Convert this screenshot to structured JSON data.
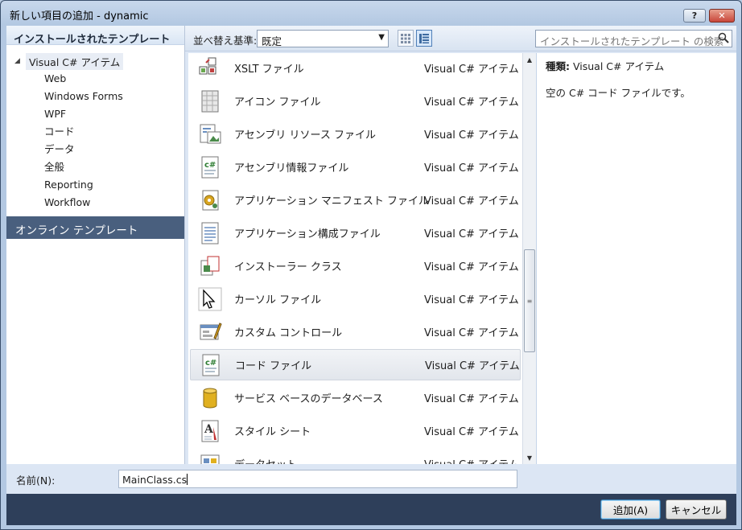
{
  "window": {
    "title": "新しい項目の追加 - dynamic",
    "help_label": "?",
    "close_label": "✕"
  },
  "left_pane": {
    "header": "インストールされたテンプレート",
    "tree_root": "Visual C# アイテム",
    "tree_children": [
      "Web",
      "Windows Forms",
      "WPF",
      "コード",
      "データ",
      "全般",
      "Reporting",
      "Workflow"
    ],
    "online_templates": "オンライン テンプレート"
  },
  "toolbar": {
    "sort_label": "並べ替え基準:",
    "sort_value": "既定",
    "search_placeholder": "インストールされたテンプレート の検索"
  },
  "templates": [
    {
      "name": "XSLT ファイル",
      "kind": "Visual C# アイテム",
      "icon": "xslt-file-icon"
    },
    {
      "name": "アイコン ファイル",
      "kind": "Visual C# アイテム",
      "icon": "icon-file-icon"
    },
    {
      "name": "アセンブリ リソース ファイル",
      "kind": "Visual C# アイテム",
      "icon": "resource-file-icon"
    },
    {
      "name": "アセンブリ情報ファイル",
      "kind": "Visual C# アイテム",
      "icon": "csharp-file-icon"
    },
    {
      "name": "アプリケーション マニフェスト ファイル",
      "kind": "Visual C# アイテム",
      "icon": "manifest-file-icon"
    },
    {
      "name": "アプリケーション構成ファイル",
      "kind": "Visual C# アイテム",
      "icon": "config-file-icon"
    },
    {
      "name": "インストーラー クラス",
      "kind": "Visual C# アイテム",
      "icon": "installer-class-icon"
    },
    {
      "name": "カーソル ファイル",
      "kind": "Visual C# アイテム",
      "icon": "cursor-file-icon"
    },
    {
      "name": "カスタム コントロール",
      "kind": "Visual C# アイテム",
      "icon": "custom-control-icon"
    },
    {
      "name": "コード ファイル",
      "kind": "Visual C# アイテム",
      "icon": "csharp-file-icon",
      "selected": true
    },
    {
      "name": "サービス ベースのデータベース",
      "kind": "Visual C# アイテム",
      "icon": "database-icon"
    },
    {
      "name": "スタイル シート",
      "kind": "Visual C# アイテム",
      "icon": "stylesheet-icon"
    },
    {
      "name": "データセット",
      "kind": "Visual C# アイテム",
      "icon": "dataset-icon"
    }
  ],
  "details": {
    "kind_label": "種類:",
    "kind_value": "Visual C# アイテム",
    "description": "空の C# コード ファイルです。"
  },
  "name_field": {
    "label": "名前(N):",
    "value": "MainClass.cs"
  },
  "buttons": {
    "add": "追加(A)",
    "cancel": "キャンセル"
  },
  "colors": {
    "selection_header": "#495f7e",
    "footer": "#2e3f5a",
    "accent": "#3c7fb1"
  }
}
